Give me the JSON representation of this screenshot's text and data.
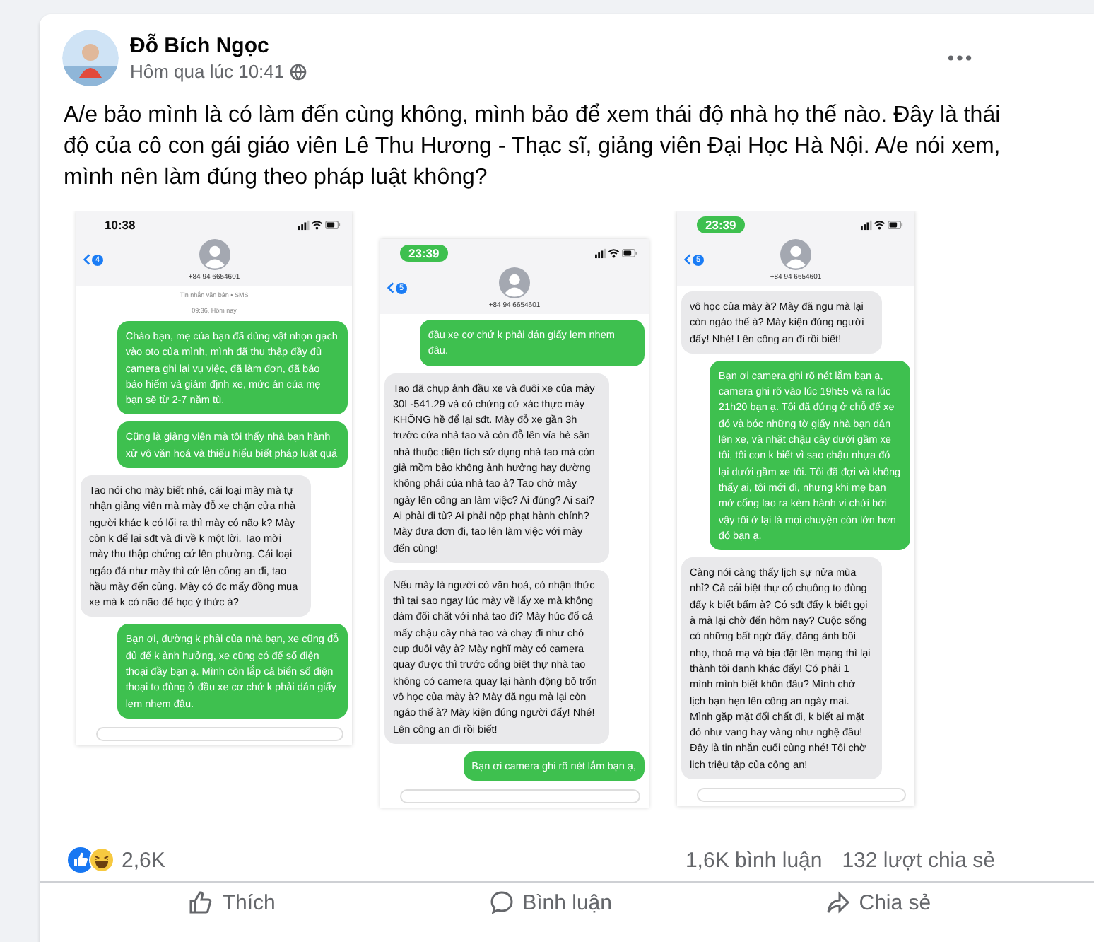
{
  "post": {
    "author": "Đỗ Bích Ngọc",
    "time": "Hôm qua lúc 10:41",
    "text": "A/e bảo mình là có làm đến cùng không, mình bảo để xem thái độ nhà họ thế nào. Đây là thái độ của cô con gái giáo viên Lê Thu Hương - Thạc sĩ, giảng viên Đại Học Hà Nội. A/e nói xem, mình nên làm đúng theo pháp luật không?"
  },
  "screenshots": [
    {
      "time": "10:38",
      "call_active": false,
      "badge": "4",
      "phone": "+84 94 6654601",
      "meta": [
        "Tin nhắn văn bản • SMS",
        "09:36, Hôm nay"
      ],
      "messages": [
        {
          "kind": "sent",
          "text": "Chào bạn, mẹ của bạn đã dùng vật nhọn gạch vào oto của mình, mình đã thu thập đầy đủ camera ghi lại vụ việc, đã làm đơn, đã báo bảo hiểm và giám định xe, mức án của mẹ bạn sẽ từ 2-7 năm tù."
        },
        {
          "kind": "sent",
          "text": "Cũng là giảng viên mà tôi thấy nhà bạn hành xử vô văn hoá và thiếu hiểu biết pháp luật quá"
        },
        {
          "kind": "received",
          "text": "Tao nói cho mày biết nhé, cái loại mày mà tự nhận giảng viên mà mày đỗ xe chặn cửa nhà người khác k có lối ra thì mày có não k? Mày còn k để lại sđt và đi về k một lời. Tao mời mày thu thập chứng cứ lên phường. Cái loại ngáo đá như mày thì cứ lên công an đi, tao hầu mày đến cùng. Mày có đc mấy đồng mua xe mà k có não để học ý thức à?"
        },
        {
          "kind": "sent",
          "text": "Bạn ơi, đường k phải của nhà bạn, xe cũng đỗ đủ để k ảnh hưởng, xe cũng có để số điện thoại đầy bạn ạ. Mình còn lắp cả biển số điện thoại to đùng ở đầu xe cơ chứ k phải dán giấy lem nhem đâu."
        }
      ]
    },
    {
      "time": "23:39",
      "call_active": true,
      "badge": "5",
      "phone": "+84 94 6654601",
      "messages": [
        {
          "kind": "sent",
          "text": "đầu xe cơ chứ k phải dán giấy lem nhem đâu."
        },
        {
          "kind": "received",
          "text": "Tao đã chụp ảnh đầu xe và đuôi xe của mày 30L-541.29 và có chứng cứ xác thực mày KHÔNG hề để lại sđt. Mày đỗ xe gần 3h trước cửa nhà tao và còn đỗ lên vỉa hè sân nhà thuộc diện tích sử dụng nhà tao mà còn giả mồm bảo không ảnh hưởng hay đường không phải của nhà tao à? Tao chờ mày ngày lên công an làm việc? Ai đúng? Ai sai? Ai phải đi tù? Ai phải nộp phạt hành chính? Mày đưa đơn đi, tao lên làm việc với mày đến cùng!"
        },
        {
          "kind": "received",
          "text": "Nếu mày là người có văn hoá, có nhận thức thì tại sao ngay lúc mày về lấy xe mà không dám đối chất với nhà tao đi? Mày húc đổ cả mấy chậu cây nhà tao và chạy đi như chó cụp đuôi vậy à? Mày nghĩ mày có camera quay được thì trước cổng biệt thự nhà tao không có camera quay lại hành động bỏ trốn vô học của mày à? Mày đã ngu mà lại còn ngáo thế à? Mày kiện đúng người đấy! Nhé! Lên công an đi rồi biết!"
        },
        {
          "kind": "sent",
          "text": "Bạn ơi camera ghi rõ nét lắm bạn ạ,"
        }
      ]
    },
    {
      "time": "23:39",
      "call_active": true,
      "badge": "5",
      "phone": "+84 94 6654601",
      "messages": [
        {
          "kind": "received",
          "text": "vô học của mày à? Mày đã ngu mà lại còn ngáo thế à? Mày kiện đúng người đấy! Nhé! Lên công an đi rồi biết!"
        },
        {
          "kind": "sent",
          "text": "Bạn ơi camera ghi rõ nét lắm bạn ạ, camera ghi rõ vào lúc 19h55 và ra lúc 21h20 bạn ạ. Tôi đã đứng ở chỗ để xe đó và bóc những tờ giấy nhà bạn dán lên xe, và nhặt chậu cây dưới gầm xe tôi, tôi con k biết vì sao chậu nhựa đó lại dưới gầm xe tôi. Tôi đã đợi và không thấy ai, tôi mới đi, nhưng khi mẹ bạn mở cổng lao ra kèm hành vi chửi bới vậy tôi ở lại là mọi chuyện còn lớn hơn đó bạn ạ."
        },
        {
          "kind": "received",
          "text": "Càng nói càng thấy lịch sự nửa mùa nhỉ? Cả cái biệt thự có chuông to đùng đấy k biết bấm à? Có sđt đấy k biết gọi à mà lại chờ đến hôm nay? Cuộc sống có những bất ngờ đấy, đăng ảnh bôi nhọ, thoá mạ và bịa đặt lên mạng thì lại thành tội danh khác đấy! Có phải 1 mình mình biết khôn đâu? Mình chờ lịch bạn hẹn lên công an ngày mai. Mình gặp mặt đối chất đi, k biết ai mặt đỏ như vang hay vàng như nghệ đâu! Đây là tin nhắn cuối cùng nhé! Tôi chờ lịch triệu tập của công an!"
        }
      ]
    }
  ],
  "reactions": {
    "count": "2,6K",
    "comments": "1,6K bình luận",
    "shares": "132 lượt chia sẻ"
  },
  "actions": [
    "Thích",
    "Bình luận",
    "Chia sẻ"
  ]
}
